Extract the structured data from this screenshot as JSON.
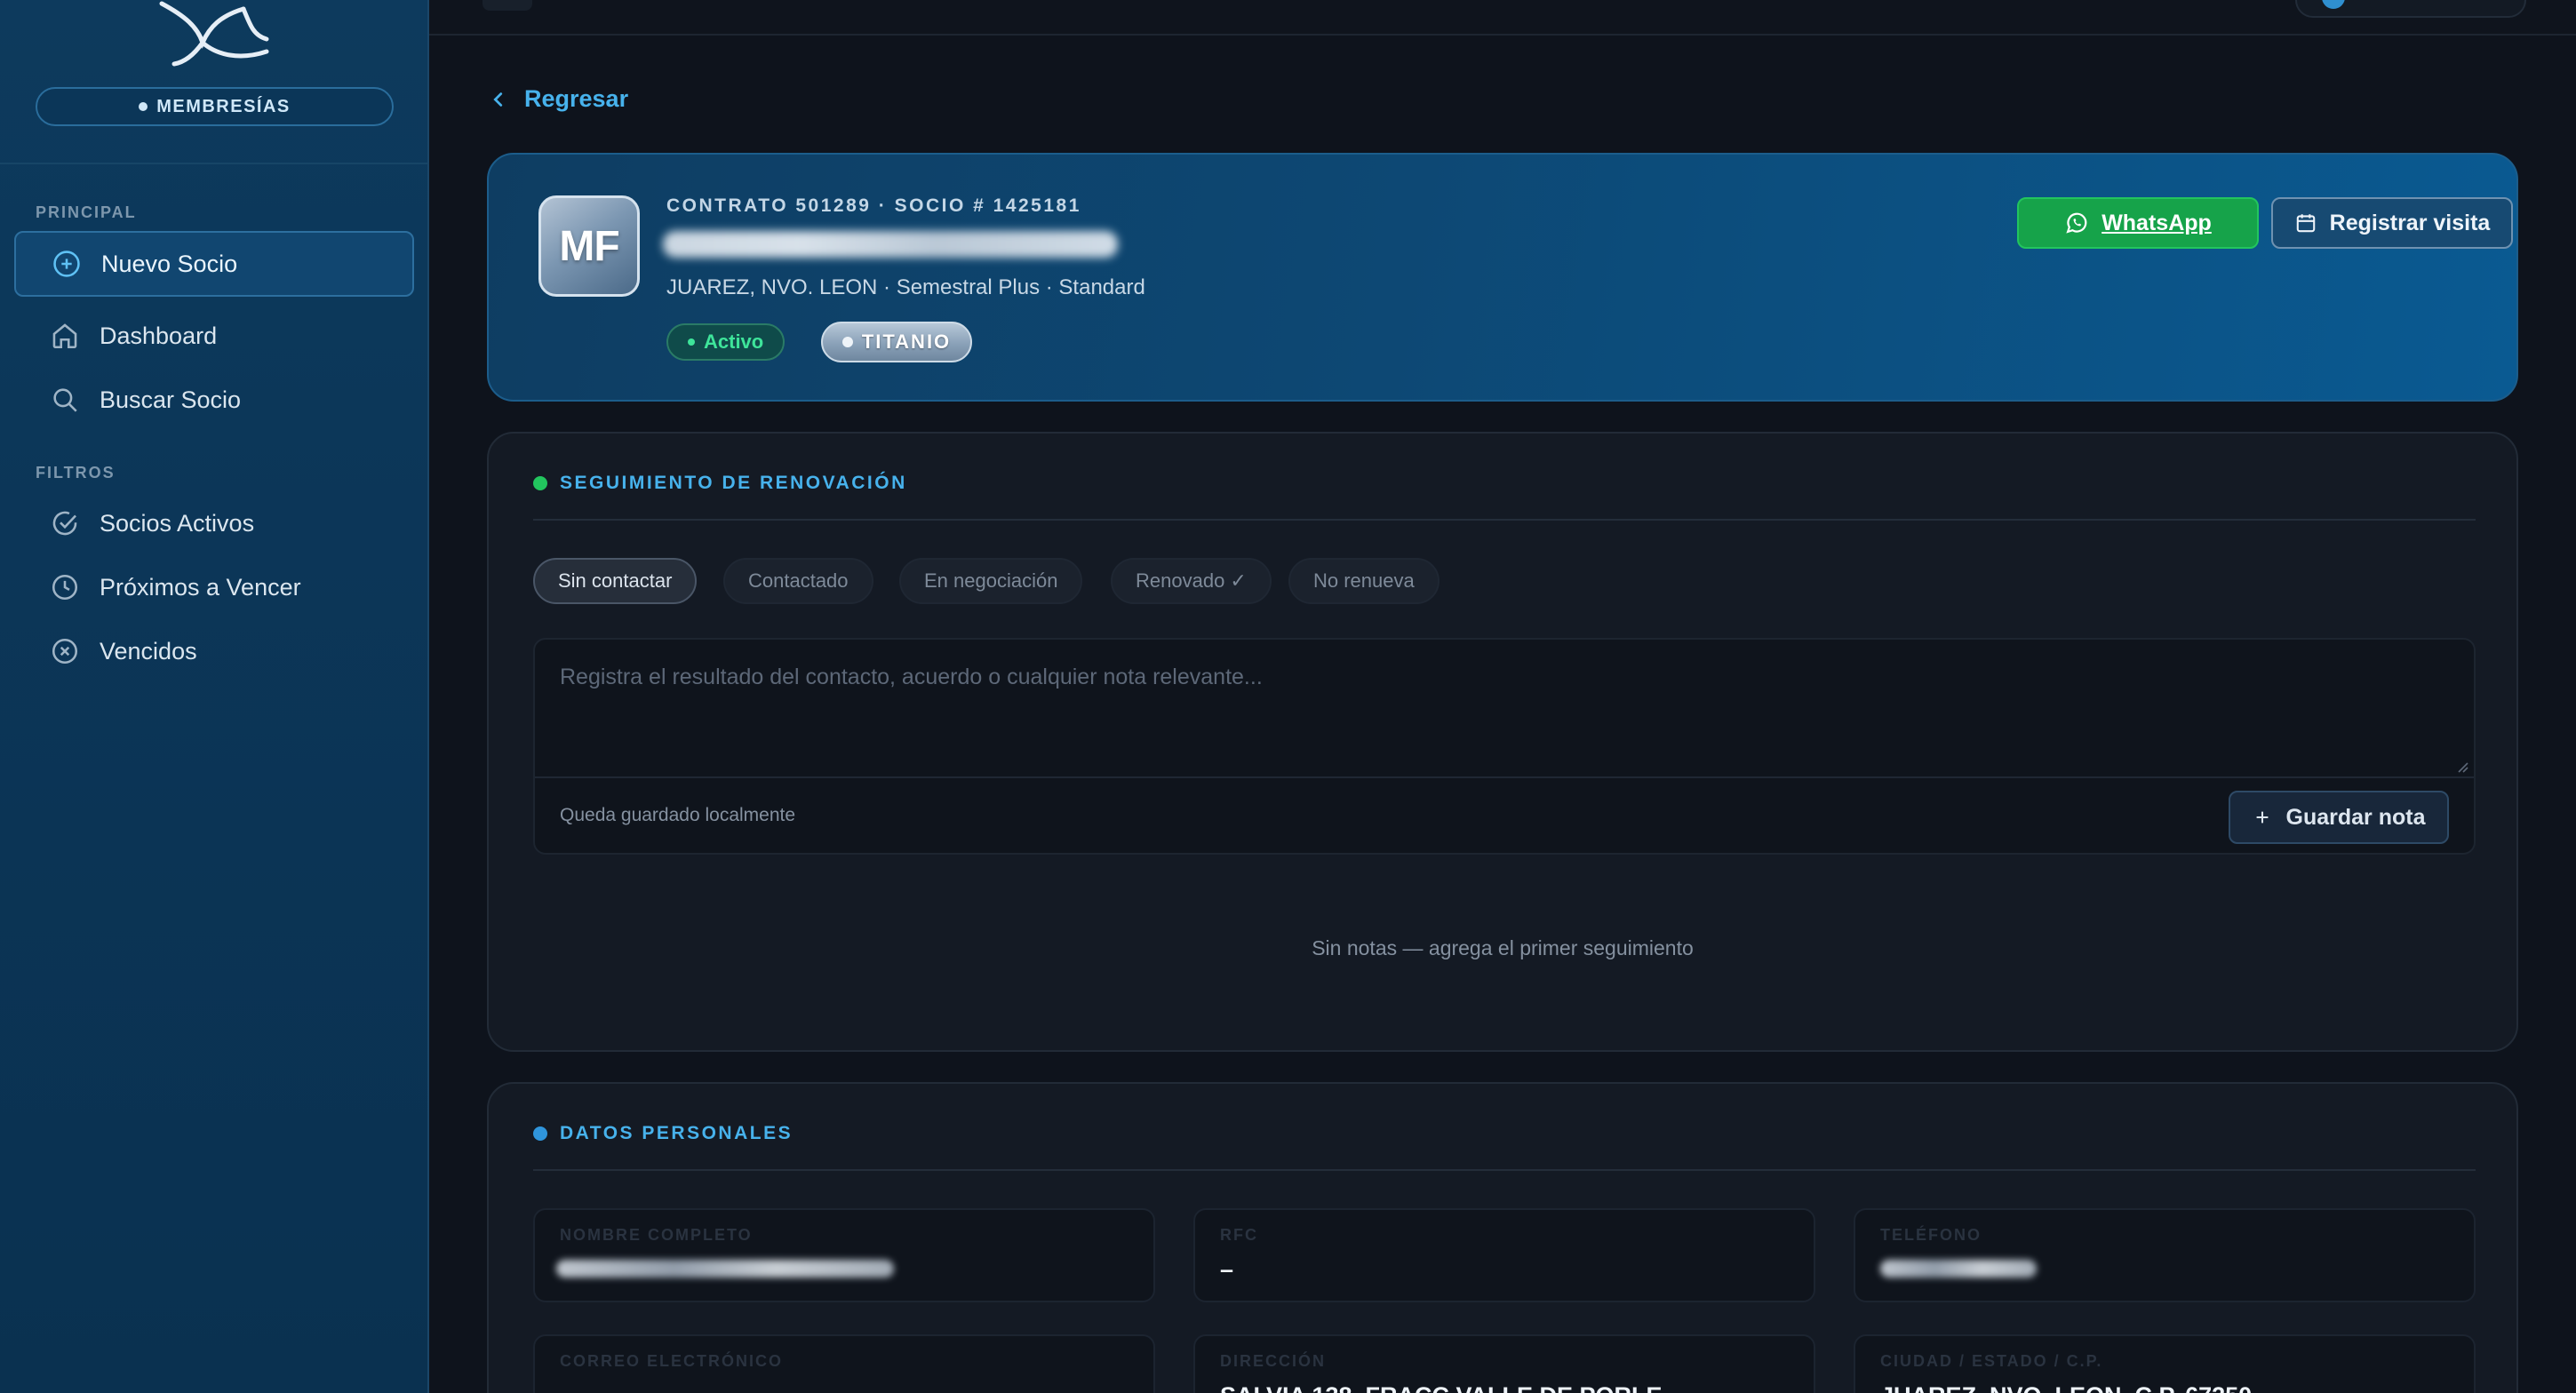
{
  "sidebar": {
    "brand_label": "MEMBRESÍAS",
    "sections": {
      "principal": "PRINCIPAL",
      "filtros": "FILTROS"
    },
    "items": [
      {
        "label": "Nuevo Socio",
        "icon": "plus-circle-icon",
        "active": true
      },
      {
        "label": "Dashboard",
        "icon": "home-icon",
        "active": false
      },
      {
        "label": "Buscar Socio",
        "icon": "search-icon",
        "active": false
      },
      {
        "label": "Socios Activos",
        "icon": "check-circle-icon",
        "active": false
      },
      {
        "label": "Próximos a Vencer",
        "icon": "clock-icon",
        "active": false
      },
      {
        "label": "Vencidos",
        "icon": "x-circle-icon",
        "active": false
      }
    ]
  },
  "back_link": {
    "label": "Regresar",
    "icon": "chevron-left-icon"
  },
  "member": {
    "initials": "MF",
    "contract_line": "CONTRATO 501289  ·  SOCIO # 1425181",
    "subtitle": "JUAREZ, NVO. LEON · Semestral Plus · Standard",
    "status_badge": "Activo",
    "tier_badge": "TITANIO",
    "whatsapp_label": "WhatsApp",
    "visit_label": "Registrar visita"
  },
  "renewal": {
    "title": "SEGUIMIENTO DE RENOVACIÓN",
    "statuses": [
      {
        "label": "Sin contactar",
        "selected": true
      },
      {
        "label": "Contactado",
        "selected": false
      },
      {
        "label": "En negociación",
        "selected": false
      },
      {
        "label": "Renovado ✓",
        "selected": false
      },
      {
        "label": "No renueva",
        "selected": false
      }
    ],
    "note_placeholder": "Registra el resultado del contacto, acuerdo o cualquier nota relevante...",
    "saved_hint": "Queda guardado localmente",
    "save_button": "Guardar nota",
    "empty_text": "Sin notas — agrega el primer seguimiento"
  },
  "personal": {
    "title": "DATOS PERSONALES",
    "fields": [
      {
        "label": "NOMBRE COMPLETO",
        "value": ""
      },
      {
        "label": "RFC",
        "value": "–"
      },
      {
        "label": "TELÉFONO",
        "value": ""
      },
      {
        "label": "CORREO ELECTRÓNICO",
        "value": ""
      },
      {
        "label": "DIRECCIÓN",
        "value": "SALVIA 138, FRACC VALLE DE PORLE"
      },
      {
        "label": "CIUDAD / ESTADO / C.P.",
        "value": "JUAREZ, NVO. LEON, C.P. 67250"
      }
    ]
  },
  "colors": {
    "accent_blue": "#47b2ec",
    "whatsapp_green": "#16a34a",
    "active_green": "#3ee49a",
    "renewal_dot": "#22c55e",
    "personal_dot": "#2f95dc"
  }
}
